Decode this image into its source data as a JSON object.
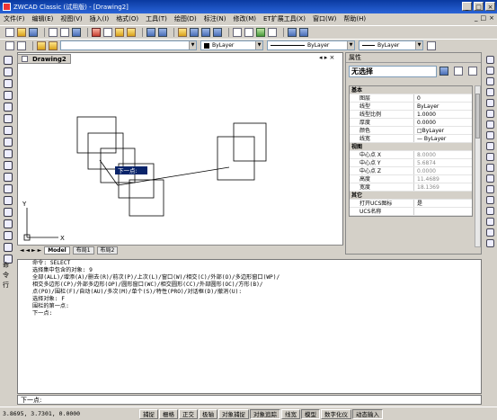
{
  "window": {
    "title": "ZWCAD Classic (试用版) - [Drawing2]",
    "buttons": [
      "_",
      "□",
      "×"
    ]
  },
  "menu": [
    "文件(F)",
    "编辑(E)",
    "视图(V)",
    "插入(I)",
    "格式(O)",
    "工具(T)",
    "绘图(D)",
    "标注(N)",
    "修改(M)",
    "ET扩展工具(X)",
    "窗口(W)",
    "帮助(H)"
  ],
  "menu_mdi": [
    "_",
    "□",
    "×"
  ],
  "layer_toolbar": {
    "color": "ByLayer",
    "linetype": "ByLayer",
    "lineweight": "ByLayer"
  },
  "document_tab": "Drawing2",
  "drawing": {
    "tooltip": "下一点:",
    "axis_y": "Y",
    "axis_x": "X",
    "layout_tabs": [
      "Model",
      "布局1",
      "布局2"
    ]
  },
  "properties": {
    "panel_title": "属性",
    "selection": "无选择",
    "rows": [
      {
        "type": "cat",
        "key": "基本"
      },
      {
        "key": "图层",
        "value": "0"
      },
      {
        "key": "线型",
        "value": "ByLayer"
      },
      {
        "key": "线型比例",
        "value": "1.0000"
      },
      {
        "key": "厚度",
        "value": "0.0000"
      },
      {
        "key": "颜色",
        "value": "□ByLayer"
      },
      {
        "key": "线宽",
        "value": "— ByLayer"
      },
      {
        "type": "cat",
        "key": "视图"
      },
      {
        "key": "中心点 X",
        "value": "8.0000",
        "dim": true
      },
      {
        "key": "中心点 Y",
        "value": "5.6874",
        "dim": true
      },
      {
        "key": "中心点 Z",
        "value": "0.0000",
        "dim": true
      },
      {
        "key": "高度",
        "value": "11.4689",
        "dim": true
      },
      {
        "key": "宽度",
        "value": "18.1369",
        "dim": true
      },
      {
        "type": "cat",
        "key": "其它"
      },
      {
        "key": "打开UCS图标",
        "value": "是"
      },
      {
        "key": "UCS名称",
        "value": ""
      }
    ]
  },
  "command": {
    "side_labels": [
      "命",
      "令",
      "行"
    ],
    "lines": [
      "命令: SELECT",
      "选择集中包含的对象: 9",
      "全部(ALL)/增添(A)/删去(R)/前次(P)/上次(L)/窗口(W)/相交(C)/外部(O)/多边形窗口(WP)/",
      "相交多边形(CP)/外部多边形(OP)/圆形窗口(WC)/相交圆形(CC)/外部圆形(OC)/方形(B)/",
      "点(PO)/围栏(F)/自动(AU)/多次(M)/单个(S)/特性(PRO)/对话框(D)/撤消(U):",
      "选择对象: F",
      "围栏的第一点:",
      "下一点:"
    ],
    "prompt": "下一点:"
  },
  "status": {
    "coords": "3.8695, 3.7301, 0.0000",
    "buttons": [
      {
        "label": "捕捉",
        "on": false
      },
      {
        "label": "栅格",
        "on": false
      },
      {
        "label": "正交",
        "on": false
      },
      {
        "label": "极轴",
        "on": false
      },
      {
        "label": "对象捕捉",
        "on": false
      },
      {
        "label": "对象追踪",
        "on": true
      },
      {
        "label": "线宽",
        "on": false
      },
      {
        "label": "模型",
        "on": true
      },
      {
        "label": "数字化仪",
        "on": false
      },
      {
        "label": "动态输入",
        "on": true
      }
    ]
  }
}
